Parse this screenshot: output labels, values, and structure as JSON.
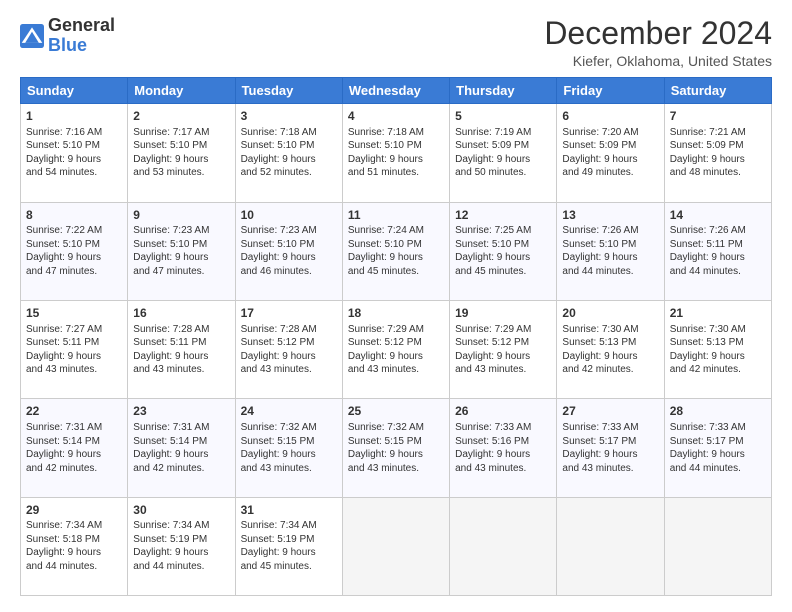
{
  "header": {
    "logo_line1": "General",
    "logo_line2": "Blue",
    "title": "December 2024",
    "subtitle": "Kiefer, Oklahoma, United States"
  },
  "columns": [
    "Sunday",
    "Monday",
    "Tuesday",
    "Wednesday",
    "Thursday",
    "Friday",
    "Saturday"
  ],
  "weeks": [
    [
      {
        "date": "1",
        "sunrise": "7:16 AM",
        "sunset": "5:10 PM",
        "daylight": "9 hours and 54 minutes."
      },
      {
        "date": "2",
        "sunrise": "7:17 AM",
        "sunset": "5:10 PM",
        "daylight": "9 hours and 53 minutes."
      },
      {
        "date": "3",
        "sunrise": "7:18 AM",
        "sunset": "5:10 PM",
        "daylight": "9 hours and 52 minutes."
      },
      {
        "date": "4",
        "sunrise": "7:18 AM",
        "sunset": "5:10 PM",
        "daylight": "9 hours and 51 minutes."
      },
      {
        "date": "5",
        "sunrise": "7:19 AM",
        "sunset": "5:09 PM",
        "daylight": "9 hours and 50 minutes."
      },
      {
        "date": "6",
        "sunrise": "7:20 AM",
        "sunset": "5:09 PM",
        "daylight": "9 hours and 49 minutes."
      },
      {
        "date": "7",
        "sunrise": "7:21 AM",
        "sunset": "5:09 PM",
        "daylight": "9 hours and 48 minutes."
      }
    ],
    [
      {
        "date": "8",
        "sunrise": "7:22 AM",
        "sunset": "5:10 PM",
        "daylight": "9 hours and 47 minutes."
      },
      {
        "date": "9",
        "sunrise": "7:23 AM",
        "sunset": "5:10 PM",
        "daylight": "9 hours and 47 minutes."
      },
      {
        "date": "10",
        "sunrise": "7:23 AM",
        "sunset": "5:10 PM",
        "daylight": "9 hours and 46 minutes."
      },
      {
        "date": "11",
        "sunrise": "7:24 AM",
        "sunset": "5:10 PM",
        "daylight": "9 hours and 45 minutes."
      },
      {
        "date": "12",
        "sunrise": "7:25 AM",
        "sunset": "5:10 PM",
        "daylight": "9 hours and 45 minutes."
      },
      {
        "date": "13",
        "sunrise": "7:26 AM",
        "sunset": "5:10 PM",
        "daylight": "9 hours and 44 minutes."
      },
      {
        "date": "14",
        "sunrise": "7:26 AM",
        "sunset": "5:11 PM",
        "daylight": "9 hours and 44 minutes."
      }
    ],
    [
      {
        "date": "15",
        "sunrise": "7:27 AM",
        "sunset": "5:11 PM",
        "daylight": "9 hours and 43 minutes."
      },
      {
        "date": "16",
        "sunrise": "7:28 AM",
        "sunset": "5:11 PM",
        "daylight": "9 hours and 43 minutes."
      },
      {
        "date": "17",
        "sunrise": "7:28 AM",
        "sunset": "5:12 PM",
        "daylight": "9 hours and 43 minutes."
      },
      {
        "date": "18",
        "sunrise": "7:29 AM",
        "sunset": "5:12 PM",
        "daylight": "9 hours and 43 minutes."
      },
      {
        "date": "19",
        "sunrise": "7:29 AM",
        "sunset": "5:12 PM",
        "daylight": "9 hours and 43 minutes."
      },
      {
        "date": "20",
        "sunrise": "7:30 AM",
        "sunset": "5:13 PM",
        "daylight": "9 hours and 42 minutes."
      },
      {
        "date": "21",
        "sunrise": "7:30 AM",
        "sunset": "5:13 PM",
        "daylight": "9 hours and 42 minutes."
      }
    ],
    [
      {
        "date": "22",
        "sunrise": "7:31 AM",
        "sunset": "5:14 PM",
        "daylight": "9 hours and 42 minutes."
      },
      {
        "date": "23",
        "sunrise": "7:31 AM",
        "sunset": "5:14 PM",
        "daylight": "9 hours and 42 minutes."
      },
      {
        "date": "24",
        "sunrise": "7:32 AM",
        "sunset": "5:15 PM",
        "daylight": "9 hours and 43 minutes."
      },
      {
        "date": "25",
        "sunrise": "7:32 AM",
        "sunset": "5:15 PM",
        "daylight": "9 hours and 43 minutes."
      },
      {
        "date": "26",
        "sunrise": "7:33 AM",
        "sunset": "5:16 PM",
        "daylight": "9 hours and 43 minutes."
      },
      {
        "date": "27",
        "sunrise": "7:33 AM",
        "sunset": "5:17 PM",
        "daylight": "9 hours and 43 minutes."
      },
      {
        "date": "28",
        "sunrise": "7:33 AM",
        "sunset": "5:17 PM",
        "daylight": "9 hours and 44 minutes."
      }
    ],
    [
      {
        "date": "29",
        "sunrise": "7:34 AM",
        "sunset": "5:18 PM",
        "daylight": "9 hours and 44 minutes."
      },
      {
        "date": "30",
        "sunrise": "7:34 AM",
        "sunset": "5:19 PM",
        "daylight": "9 hours and 44 minutes."
      },
      {
        "date": "31",
        "sunrise": "7:34 AM",
        "sunset": "5:19 PM",
        "daylight": "9 hours and 45 minutes."
      },
      null,
      null,
      null,
      null
    ]
  ]
}
